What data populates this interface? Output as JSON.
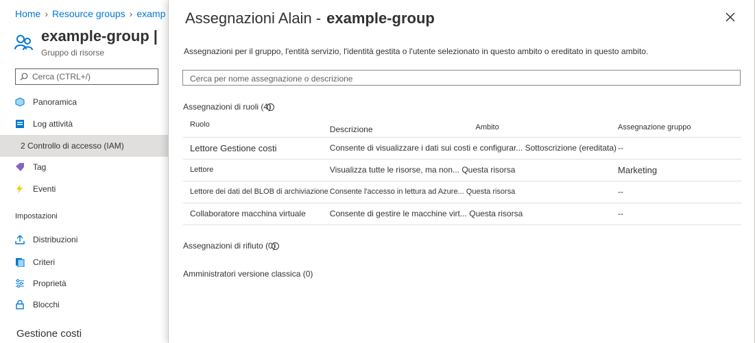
{
  "breadcrumb": {
    "home": "Home",
    "resource_groups": "Resource groups",
    "current": "examp"
  },
  "resource": {
    "title": "example-group |",
    "subtitle": "Gruppo di risorse"
  },
  "nav": {
    "search_placeholder": "Cerca (CTRL+/)",
    "items": [
      {
        "label": "Panoramica",
        "icon": "cube-icon",
        "color": "#0078d4"
      },
      {
        "label": "Log attività",
        "icon": "log-icon",
        "color": "#0078d4"
      },
      {
        "label": "2 Controllo di accesso (IAM)",
        "icon": "",
        "active": true
      },
      {
        "label": "Tag",
        "icon": "tag-icon",
        "color": "#8661c5"
      },
      {
        "label": "Eventi",
        "icon": "lightning-icon",
        "color": "#f2c811"
      }
    ],
    "settings_header": "Impostazioni",
    "settings_items": [
      {
        "label": "Distribuzioni",
        "icon": "upload-icon"
      },
      {
        "label": "Criteri",
        "icon": "policy-icon"
      },
      {
        "label": "Proprietà",
        "icon": "sliders-icon"
      },
      {
        "label": "Blocchi",
        "icon": "lock-icon"
      }
    ],
    "cost_header": "Gestione costi"
  },
  "panel": {
    "title_prefix": "Assegnazioni Alain -",
    "title_bold": "example-group",
    "description": "Assegnazioni per il gruppo, l'entità servizio, l'identità gestita o l'utente selezionato in questo ambito o ereditato in questo ambito.",
    "search_placeholder": "Cerca per nome assegnazione o descrizione",
    "role_assignments_label": "Assegnazioni di ruoli (4)",
    "deny_assignments_label": "Assegnazioni di rifiuto (0)",
    "classic_admins_label": "Amministratori versione classica (0)",
    "columns": [
      "Ruolo",
      "Descrizione",
      "Ambito",
      "Assegnazione gruppo"
    ],
    "rows": [
      {
        "role": "Lettore Gestione costi",
        "description": "Consente di visualizzare i dati sui costi e configurar...",
        "scope": "Sottoscrizione (ereditata)",
        "group": "--"
      },
      {
        "role": "Lettore",
        "description": "Visualizza tutte le risorse, ma non...",
        "scope": "Questa risorsa",
        "group": "Marketing"
      },
      {
        "role": "Lettore dei dati del BLOB di archiviazione",
        "description": "Consente l'accesso in lettura ad Azure...",
        "scope": "Questa risorsa",
        "group": "--"
      },
      {
        "role": "Collaboratore macchina virtuale",
        "description": "Consente di gestire le macchine virt...",
        "scope": "Questa risorsa",
        "group": "--"
      }
    ]
  },
  "colors": {
    "link": "#0078d4",
    "text": "#323130",
    "active_nav": "#e1dfdd"
  }
}
